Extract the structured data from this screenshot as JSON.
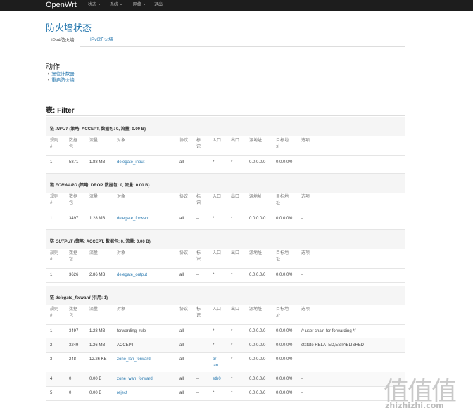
{
  "navbar": {
    "brand": "OpenWrt",
    "menu": [
      "状态",
      "系统",
      "网络",
      "退出"
    ]
  },
  "page_title": "防火墙状态",
  "tabs": [
    "IPv4防火墙",
    "IPv6防火墙"
  ],
  "actions": {
    "heading": "动作",
    "items": [
      "复位计数器",
      "重启防火墙"
    ]
  },
  "filter_heading": "表: Filter",
  "table_headers": {
    "rule": [
      "规则",
      "#"
    ],
    "packets": [
      "数据",
      "包"
    ],
    "traffic": "流量",
    "target": "对象",
    "proto": "协议",
    "flags": [
      "标",
      "识"
    ],
    "in": "入口",
    "out": "出口",
    "source": "源地址",
    "dest": [
      "目标地",
      "址"
    ],
    "options": "选项"
  },
  "chains": [
    {
      "title_name": "INPUT",
      "title_rest": "(策略: ACCEPT, 数据包: 0, 流量: 0.00 B)",
      "rows": [
        {
          "num": "1",
          "pkts": "5871",
          "traffic": "1.88 MB",
          "target": "delegate_input",
          "target_link": true,
          "proto": "all",
          "flags": "--",
          "in": "*",
          "out": "*",
          "src": "0.0.0.0/0",
          "dst": "0.0.0.0/0",
          "opt": "-"
        }
      ]
    },
    {
      "title_name": "FORWARD",
      "title_rest": "(策略: DROP, 数据包: 0, 流量: 0.00 B)",
      "rows": [
        {
          "num": "1",
          "pkts": "3497",
          "traffic": "1.28 MB",
          "target": "delegate_forward",
          "target_link": true,
          "proto": "all",
          "flags": "--",
          "in": "*",
          "out": "*",
          "src": "0.0.0.0/0",
          "dst": "0.0.0.0/0",
          "opt": "-"
        }
      ]
    },
    {
      "title_name": "OUTPUT",
      "title_rest": "(策略: ACCEPT, 数据包: 0, 流量: 0.00 B)",
      "rows": [
        {
          "num": "1",
          "pkts": "3626",
          "traffic": "2.86 MB",
          "target": "delegate_output",
          "target_link": true,
          "proto": "all",
          "flags": "--",
          "in": "*",
          "out": "*",
          "src": "0.0.0.0/0",
          "dst": "0.0.0.0/0",
          "opt": "-"
        }
      ]
    },
    {
      "title_name": "delegate_forward",
      "title_rest": "(引用: 1)",
      "rows": [
        {
          "num": "1",
          "pkts": "3497",
          "traffic": "1.28 MB",
          "target": "forwarding_rule",
          "target_link": false,
          "proto": "all",
          "flags": "--",
          "in": "*",
          "out": "*",
          "src": "0.0.0.0/0",
          "dst": "0.0.0.0/0",
          "opt": "/* user chain for forwarding */"
        },
        {
          "num": "2",
          "pkts": "3249",
          "traffic": "1.26 MB",
          "target": "ACCEPT",
          "target_link": false,
          "proto": "all",
          "flags": "--",
          "in": "*",
          "out": "*",
          "src": "0.0.0.0/0",
          "dst": "0.0.0.0/0",
          "opt": "ctstate RELATED,ESTABLISHED"
        },
        {
          "num": "3",
          "pkts": "248",
          "traffic": "12.26 KB",
          "target": "zone_lan_forward",
          "target_link": true,
          "proto": "all",
          "flags": "--",
          "in": "br-lan",
          "in_link": true,
          "out": "*",
          "src": "0.0.0.0/0",
          "dst": "0.0.0.0/0",
          "opt": "-"
        },
        {
          "num": "4",
          "pkts": "0",
          "traffic": "0.00 B",
          "target": "zone_wan_forward",
          "target_link": true,
          "proto": "all",
          "flags": "--",
          "in": "eth0",
          "in_link": true,
          "out": "*",
          "src": "0.0.0.0/0",
          "dst": "0.0.0.0/0",
          "opt": "-"
        },
        {
          "num": "5",
          "pkts": "0",
          "traffic": "0.00 B",
          "target": "reject",
          "target_link": true,
          "proto": "all",
          "flags": "--",
          "in": "*",
          "out": "*",
          "src": "0.0.0.0/0",
          "dst": "0.0.0.0/0",
          "opt": "-"
        }
      ]
    }
  ],
  "watermark": {
    "chars": "值值值",
    "url": "zhizhizhi.com"
  },
  "colors": {
    "accent": "#2a7ab0",
    "navbar": "#1d1d1d"
  }
}
